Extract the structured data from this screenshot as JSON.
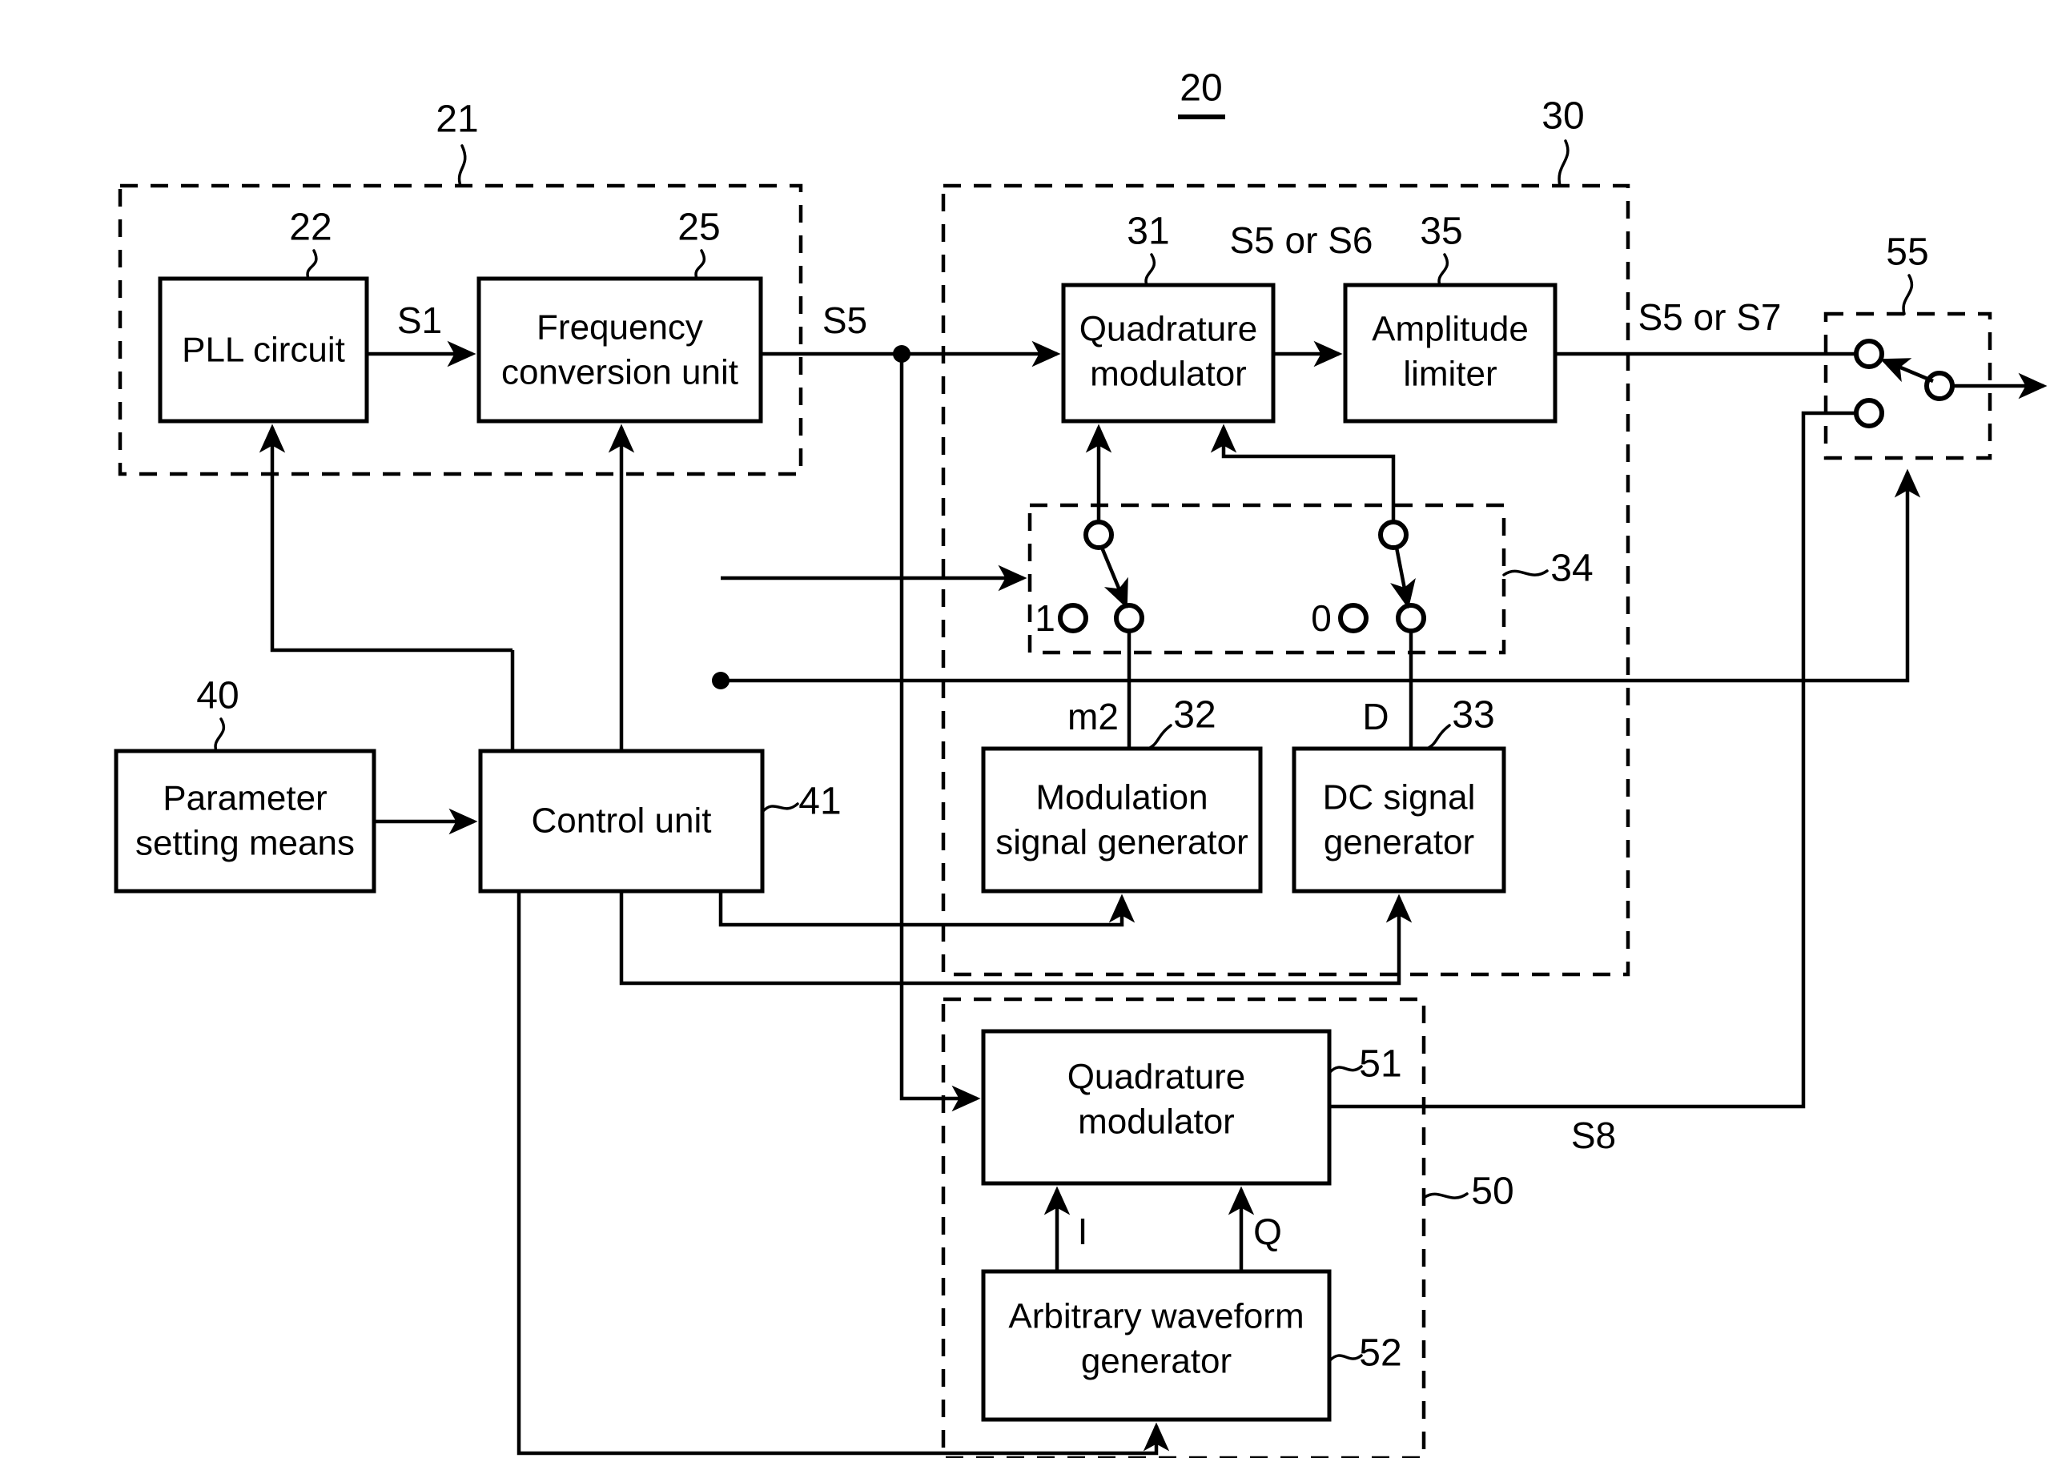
{
  "figure": {
    "kind": "patent-block-diagram",
    "background_color": "#ffffff",
    "line_color": "#000000"
  },
  "blocks": {
    "pll_circuit": {
      "label": "PLL circuit",
      "ref": "22"
    },
    "frequency_conversion_unit": {
      "label_line1": "Frequency",
      "label_line2": "conversion unit",
      "ref": "25"
    },
    "quadrature_modulator_31": {
      "label_line1": "Quadrature",
      "label_line2": "modulator",
      "ref": "31"
    },
    "amplitude_limiter": {
      "label_line1": "Amplitude",
      "label_line2": "limiter",
      "ref": "35"
    },
    "modulation_signal_generator": {
      "label_line1": "Modulation",
      "label_line2": "signal generator",
      "ref": "32"
    },
    "dc_signal_generator": {
      "label_line1": "DC signal",
      "label_line2": "generator",
      "ref": "33"
    },
    "parameter_setting_means": {
      "label_line1": "Parameter",
      "label_line2": "setting means",
      "ref": "40"
    },
    "control_unit": {
      "label": "Control unit",
      "ref": "41"
    },
    "quadrature_modulator_51": {
      "label_line1": "Quadrature",
      "label_line2": "modulator",
      "ref": "51"
    },
    "arbitrary_waveform_generator": {
      "label_line1": "Arbitrary waveform",
      "label_line2": "generator",
      "ref": "52"
    }
  },
  "groups": {
    "group_21": {
      "ref": "21"
    },
    "group_20": {
      "ref": "20",
      "underlined": true
    },
    "group_30": {
      "ref": "30"
    },
    "group_34": {
      "ref": "34"
    },
    "group_50": {
      "ref": "50"
    },
    "group_55": {
      "ref": "55"
    }
  },
  "signals": {
    "s1": "S1",
    "s5_out_of_freq_conv": "S5",
    "s5_or_s6": "S5 or S6",
    "s5_or_s7": "S5 or S7",
    "s8": "S8",
    "m2": "m2",
    "d": "D",
    "i": "I",
    "q": "Q"
  },
  "switch_terminals": {
    "left_switch_zero_state": "1",
    "right_switch_zero_state": "0"
  }
}
